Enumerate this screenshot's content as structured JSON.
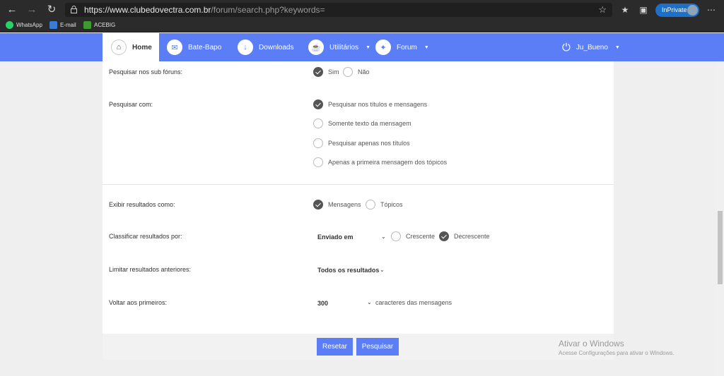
{
  "browser": {
    "url_host": "https://www.clubedovectra.com.br",
    "url_path": "/forum/search.php?keywords=",
    "inprivate_label": "InPrivate",
    "bookmarks": [
      {
        "label": "WhatsApp",
        "color": "#25d366"
      },
      {
        "label": "E-mail",
        "color": "#3a7bd5"
      },
      {
        "label": "ACEBIG",
        "color": "#3c9a2f"
      }
    ]
  },
  "nav": {
    "home": "Home",
    "chat": "Bate-Bapo",
    "downloads": "Downloads",
    "utilities": "Utilitários",
    "forum": "Forum",
    "user": "Ju_Bueno",
    "accent": "#5b7ef7"
  },
  "form": {
    "subforums_label": "Pesquisar nos sub fóruns:",
    "subforums_yes": "Sim",
    "subforums_no": "Não",
    "search_with_label": "Pesquisar com:",
    "search_opts": [
      "Pesquisar nos títulos e mensagens",
      "Somente texto da mensagem",
      "Pesquisar apenas nos títulos",
      "Apenas a primeira mensagem dos tópicos"
    ],
    "display_label": "Exibir resultados como:",
    "display_posts": "Mensagens",
    "display_topics": "Tópicos",
    "sort_label": "Classificar resultados por:",
    "sort_value": "Enviado em",
    "sort_asc": "Crescente",
    "sort_desc": "Decrescente",
    "limit_label": "Limitar resultados anteriores:",
    "limit_value": "Todos os resultados",
    "return_label": "Voltar aos primeiros:",
    "return_value": "300",
    "return_suffix": "caracteres das mensagens"
  },
  "buttons": {
    "reset": "Resetar",
    "search": "Pesquisar"
  },
  "watermark": {
    "title": "Ativar o Windows",
    "subtitle": "Acesse Configurações para ativar o Windows."
  }
}
